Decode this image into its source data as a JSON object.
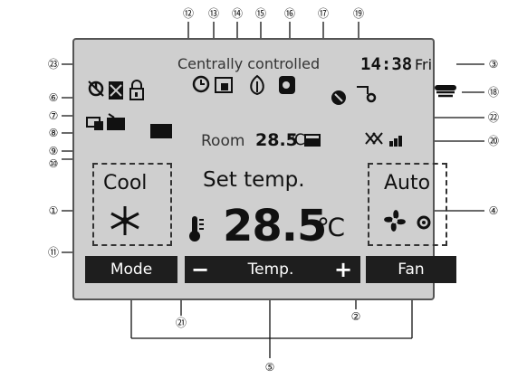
{
  "status": {
    "central_text": "Centrally controlled",
    "clock": "14:38",
    "day": "Fri"
  },
  "room": {
    "label": "Room",
    "value": "28.5",
    "unit": "℃"
  },
  "mode_box": {
    "label": "Cool",
    "icon": "snowflake-icon"
  },
  "set_temp": {
    "label": "Set temp.",
    "value": "28.5",
    "unit": "℃"
  },
  "fan_box": {
    "label": "Auto",
    "icons": [
      "fan-icon",
      "auto-fan-icon"
    ]
  },
  "softkeys": {
    "mode": "Mode",
    "temp_minus": "−",
    "temp": "Temp.",
    "temp_plus": "+",
    "fan": "Fan"
  },
  "callouts": {
    "c1": "①",
    "c2": "②",
    "c3": "③",
    "c4": "④",
    "c5": "⑤",
    "c6": "⑥",
    "c7": "⑦",
    "c8": "⑧",
    "c9": "⑨",
    "c10": "⑩",
    "c11": "⑪",
    "c12": "⑫",
    "c13": "⑬",
    "c14": "⑭",
    "c15": "⑮",
    "c16": "⑯",
    "c17": "⑰",
    "c18": "⑱",
    "c19": "⑲",
    "c20": "⑳",
    "c21": "㉑",
    "c22": "㉒",
    "c23": "㉓"
  },
  "colors": {
    "screen_bg": "#cfcfcf",
    "softkey_bg": "#1e1e1e",
    "ink": "#111111"
  }
}
